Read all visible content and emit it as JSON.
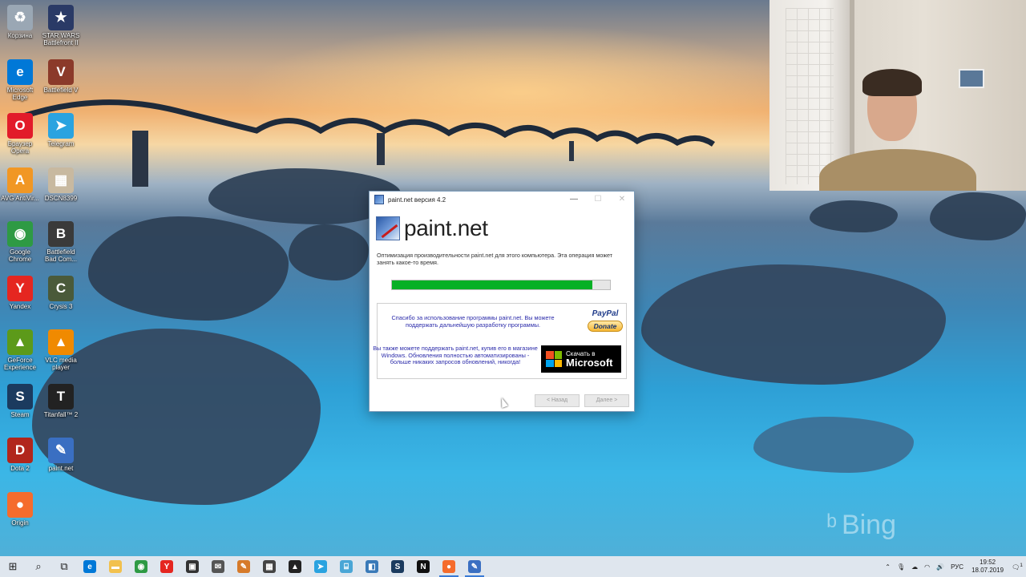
{
  "desktop": {
    "icons_left": [
      {
        "label": "Корзина",
        "icon": "recycle-bin-icon",
        "color": "#9aa7b4",
        "glyph": "♻"
      },
      {
        "label": "Microsoft Edge",
        "icon": "edge-icon",
        "color": "#0078d7",
        "glyph": "e"
      },
      {
        "label": "Браузер Opera",
        "icon": "opera-icon",
        "color": "#e21b2a",
        "glyph": "O"
      },
      {
        "label": "AVG AntiVir...",
        "icon": "avg-icon",
        "color": "#f19724",
        "glyph": "A"
      },
      {
        "label": "Google Chrome",
        "icon": "chrome-icon",
        "color": "#2e9a44",
        "glyph": "◉"
      },
      {
        "label": "Yandex",
        "icon": "yandex-icon",
        "color": "#e52620",
        "glyph": "Y"
      },
      {
        "label": "GeForce Experience",
        "icon": "geforce-icon",
        "color": "#5c9a1a",
        "glyph": "▲"
      },
      {
        "label": "Steam",
        "icon": "steam-icon",
        "color": "#1b3b5f",
        "glyph": "S"
      },
      {
        "label": "Dota 2",
        "icon": "dota-icon",
        "color": "#b1261c",
        "glyph": "D"
      },
      {
        "label": "Origin",
        "icon": "origin-icon",
        "color": "#f56c2d",
        "glyph": "●"
      }
    ],
    "icons_right": [
      {
        "label": "STAR WARS Battlefront II",
        "icon": "starwars-icon",
        "color": "#2a3a66",
        "glyph": "★"
      },
      {
        "label": "Battlefield V",
        "icon": "battlefield-v-icon",
        "color": "#8b3a2a",
        "glyph": "V"
      },
      {
        "label": "Telegram",
        "icon": "telegram-icon",
        "color": "#2aa3e0",
        "glyph": "➤"
      },
      {
        "label": "DSCN8399",
        "icon": "photo-file-icon",
        "color": "#c8b9a0",
        "glyph": "▦"
      },
      {
        "label": "Battlefield Bad Com...",
        "icon": "battlefield-bc-icon",
        "color": "#3a3a3a",
        "glyph": "B"
      },
      {
        "label": "Crysis 3",
        "icon": "crysis-icon",
        "color": "#4a5a3a",
        "glyph": "C"
      },
      {
        "label": "VLC media player",
        "icon": "vlc-icon",
        "color": "#f08a00",
        "glyph": "▲"
      },
      {
        "label": "Titanfall™ 2",
        "icon": "titanfall-icon",
        "color": "#222222",
        "glyph": "T"
      },
      {
        "label": "paint.net",
        "icon": "paintnet-icon",
        "color": "#3a6fc2",
        "glyph": "✎"
      }
    ],
    "watermark": "Bing"
  },
  "dialog": {
    "title": "paint.net версия 4.2",
    "brand": "paint.net",
    "message": "Оптимизация производительности paint.net для этого компьютера. Эта операция может занять какое-то время.",
    "progress_fraction": 0.92,
    "donate_text": "Спасибо за использование программы paint.net. Вы можете поддержать дальнейшую разработку программы.",
    "paypal_label": "PayPal",
    "donate_label": "Donate",
    "store_text": "Вы также можете поддержать paint.net, купив его в магазине Windows. Обновления полностью автоматизированы - больше никаких запросов обновлений, никогда!",
    "store_button_line1": "Скачать в",
    "store_button_line2": "Microsoft",
    "back_label": "< Назад",
    "next_label": "Далее >"
  },
  "taskbar": {
    "items": [
      {
        "name": "start-button",
        "glyph": "⊞",
        "color": ""
      },
      {
        "name": "search-icon",
        "glyph": "⌕",
        "color": ""
      },
      {
        "name": "task-view-icon",
        "glyph": "⧉",
        "color": ""
      },
      {
        "name": "edge-taskbar-icon",
        "glyph": "e",
        "color": "#0078d7"
      },
      {
        "name": "explorer-taskbar-icon",
        "glyph": "▬",
        "color": "#f2c14e"
      },
      {
        "name": "chrome-taskbar-icon",
        "glyph": "◉",
        "color": "#2e9a44"
      },
      {
        "name": "yandex-taskbar-icon",
        "glyph": "Y",
        "color": "#e52620"
      },
      {
        "name": "store-taskbar-icon",
        "glyph": "▣",
        "color": "#333333"
      },
      {
        "name": "mail-taskbar-icon",
        "glyph": "✉",
        "color": "#555555"
      },
      {
        "name": "paint-taskbar-icon",
        "glyph": "✎",
        "color": "#d67a2a"
      },
      {
        "name": "calculator-taskbar-icon",
        "glyph": "▦",
        "color": "#444444"
      },
      {
        "name": "photos-taskbar-icon",
        "glyph": "▲",
        "color": "#222222"
      },
      {
        "name": "telegram-taskbar-icon",
        "glyph": "➤",
        "color": "#2aa3e0"
      },
      {
        "name": "network-taskbar-icon",
        "glyph": "⌸",
        "color": "#4aa6d6"
      },
      {
        "name": "files-taskbar-icon",
        "glyph": "◧",
        "color": "#3a7ab8"
      },
      {
        "name": "steam-taskbar-icon",
        "glyph": "S",
        "color": "#1b3b5f"
      },
      {
        "name": "netflix-taskbar-icon",
        "glyph": "N",
        "color": "#111111"
      },
      {
        "name": "origin-taskbar-icon",
        "glyph": "●",
        "color": "#f56c2d"
      },
      {
        "name": "paintnet-taskbar-icon",
        "glyph": "✎",
        "color": "#3a6fc2"
      }
    ],
    "language": "РУС",
    "time": "19:52",
    "date": "18.07.2019",
    "notification_count": "1"
  }
}
